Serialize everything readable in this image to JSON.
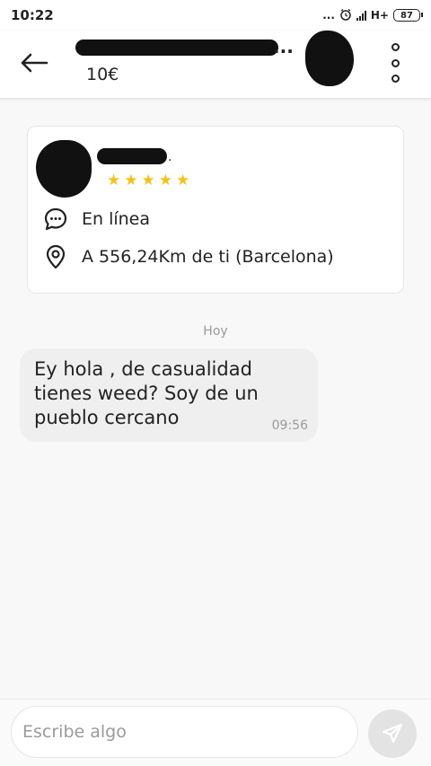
{
  "status_bar": {
    "time": "10:22",
    "dots": "...",
    "network": "H+",
    "battery": "87"
  },
  "header": {
    "title": "...",
    "price": "10€"
  },
  "profile": {
    "name_suffix": ".",
    "rating": 5,
    "status": "En línea",
    "location": "A 556,24Km de ti (Barcelona)"
  },
  "chat": {
    "date_separator": "Hoy",
    "messages": [
      {
        "text": "Ey hola , de casualidad tienes weed? Soy de un pueblo cercano",
        "time": "09:56"
      }
    ]
  },
  "composer": {
    "placeholder": "Escribe algo"
  },
  "colors": {
    "star": "#f3c21a",
    "bubble": "#efefef",
    "send_button": "#e3e3e3",
    "muted_text": "#9a9a9a"
  },
  "icons": {
    "back": "arrow-left-icon",
    "more": "more-vertical-icon",
    "online": "chat-bubble-icon",
    "location": "map-pin-icon",
    "send": "paper-plane-icon",
    "alarm": "alarm-clock-icon"
  }
}
